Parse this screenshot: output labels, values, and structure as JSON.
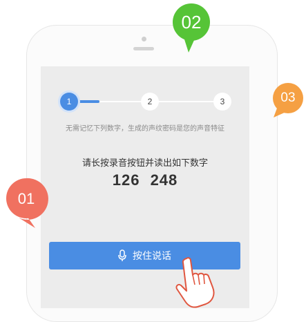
{
  "callouts": {
    "first": "01",
    "second": "02",
    "third": "03"
  },
  "steps": [
    "1",
    "2",
    "3"
  ],
  "hint": "无需记忆下列数字，生成的声纹密码是您的声音特征",
  "instruction": "请长按录音按钮并读出如下数字",
  "digits": {
    "group1": "126",
    "group2": "248"
  },
  "talk_button": {
    "label": "按住说话",
    "icon": "microphone-icon"
  },
  "colors": {
    "accent": "#4a8de3",
    "callout_01": "#f07160",
    "callout_02": "#56c437",
    "callout_03": "#f5a043"
  }
}
